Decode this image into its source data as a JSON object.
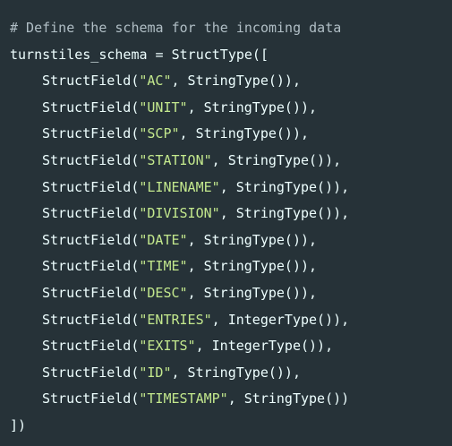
{
  "code": {
    "comment": "# Define the schema for the incoming data",
    "schema_open": "turnstiles_schema = StructType([",
    "fields": [
      {
        "pre": "StructField(",
        "name": "\"AC\"",
        "post": ", StringType()),"
      },
      {
        "pre": "StructField(",
        "name": "\"UNIT\"",
        "post": ", StringType()),"
      },
      {
        "pre": "StructField(",
        "name": "\"SCP\"",
        "post": ", StringType()),"
      },
      {
        "pre": "StructField(",
        "name": "\"STATION\"",
        "post": ", StringType()),"
      },
      {
        "pre": "StructField(",
        "name": "\"LINENAME\"",
        "post": ", StringType()),"
      },
      {
        "pre": "StructField(",
        "name": "\"DIVISION\"",
        "post": ", StringType()),"
      },
      {
        "pre": "StructField(",
        "name": "\"DATE\"",
        "post": ", StringType()),"
      },
      {
        "pre": "StructField(",
        "name": "\"TIME\"",
        "post": ", StringType()),"
      },
      {
        "pre": "StructField(",
        "name": "\"DESC\"",
        "post": ", StringType()),"
      },
      {
        "pre": "StructField(",
        "name": "\"ENTRIES\"",
        "post": ", IntegerType()),"
      },
      {
        "pre": "StructField(",
        "name": "\"EXITS\"",
        "post": ", IntegerType()),"
      },
      {
        "pre": "StructField(",
        "name": "\"ID\"",
        "post": ", StringType()),"
      },
      {
        "pre": "StructField(",
        "name": "\"TIMESTAMP\"",
        "post": ", StringType())"
      }
    ],
    "schema_close": "])"
  },
  "colors": {
    "background": "#263238",
    "text": "#eeffff",
    "string": "#c3e88d",
    "comment": "#b0bec5"
  }
}
